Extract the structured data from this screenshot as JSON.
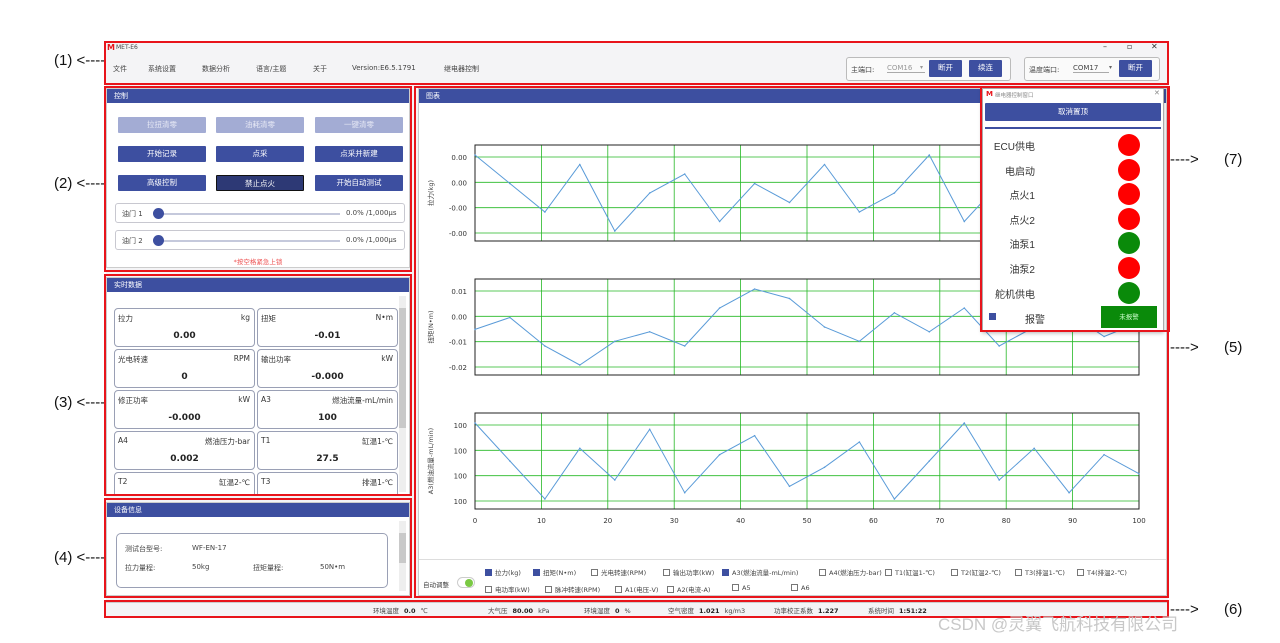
{
  "annotations": [
    "(1) <----",
    "(2) <----",
    "(3) <----",
    "(4) <----",
    "(5)",
    "(6)",
    "(7)"
  ],
  "app": {
    "title": "MET-E6",
    "menu": [
      "文件",
      "系统设置",
      "数据分析",
      "语言/主题",
      "关于",
      "Version:E6.5.1791",
      "继电器控制"
    ],
    "main_port_label": "主端口:",
    "main_port_value": "COM16",
    "disconnect": "断开",
    "resume": "续连",
    "temp_port_label": "温度端口:",
    "temp_port_value": "COM17",
    "temp_disconnect": "断开"
  },
  "control": {
    "title": "控制",
    "buttons": [
      "拉扭清零",
      "油耗清零",
      "一键清零",
      "开始记录",
      "点采",
      "点采并新建",
      "高级控制",
      "禁止点火",
      "开始自动测试"
    ],
    "throttle1_label": "油门 1",
    "throttle1_value": "0.0% /1,000μs",
    "throttle1_level": 0,
    "throttle2_label": "油门 2",
    "throttle2_value": "0.0% /1,000μs",
    "throttle2_level": 0,
    "hint": "*按空格紧急上锁"
  },
  "realtime": {
    "title": "实时数据",
    "cards": [
      {
        "name": "拉力",
        "unit": "kg",
        "value": "0.00"
      },
      {
        "name": "扭矩",
        "unit": "N•m",
        "value": "-0.01"
      },
      {
        "name": "光电转速",
        "unit": "RPM",
        "value": "0"
      },
      {
        "name": "输出功率",
        "unit": "kW",
        "value": "-0.000"
      },
      {
        "name": "修正功率",
        "unit": "kW",
        "value": "-0.000"
      },
      {
        "name": "A3",
        "unit": "燃油流量-mL/min",
        "value": "100"
      },
      {
        "name": "A4",
        "unit": "燃油压力-bar",
        "value": "0.002"
      },
      {
        "name": "T1",
        "unit": "缸温1-℃",
        "value": "27.5"
      },
      {
        "name": "T2",
        "unit": "缸温2-℃",
        "value": ""
      },
      {
        "name": "T3",
        "unit": "排温1-℃",
        "value": ""
      }
    ]
  },
  "device": {
    "title": "设备信息",
    "model_label": "测试台型号:",
    "model_value": "WF-EN-17",
    "thrust_label": "拉力量程:",
    "thrust_value": "50kg",
    "torque_label": "扭矩量程:",
    "torque_value": "50N•m"
  },
  "chart_panel": {
    "title": "图表",
    "auto_label": "自动调整",
    "checkboxes": [
      {
        "label": "拉力(kg)",
        "checked": true
      },
      {
        "label": "扭矩(N•m)",
        "checked": true
      },
      {
        "label": "光电转速(RPM)",
        "checked": false
      },
      {
        "label": "输出功率(kW)",
        "checked": false
      },
      {
        "label": "A3(燃油流量-mL/min)",
        "checked": true
      },
      {
        "label": "A4(燃油压力-bar)",
        "checked": false
      },
      {
        "label": "T1(缸温1-℃)",
        "checked": false
      },
      {
        "label": "T2(缸温2-℃)",
        "checked": false
      },
      {
        "label": "T3(排温1-℃)",
        "checked": false
      },
      {
        "label": "T4(排温2-℃)",
        "checked": false
      },
      {
        "label": "电功率(kW)",
        "checked": false
      },
      {
        "label": "脉冲转速(RPM)",
        "checked": false
      },
      {
        "label": "A1(电压-V)",
        "checked": false
      },
      {
        "label": "A2(电流-A)",
        "checked": false
      },
      {
        "label": "A5",
        "checked": false
      },
      {
        "label": "A6",
        "checked": false
      }
    ]
  },
  "chart_data": [
    {
      "type": "line",
      "ylabel": "拉力(kg)",
      "yticks": [
        "0.00",
        "0.00",
        "-0.00",
        "-0.00"
      ],
      "x": [
        0,
        100
      ],
      "values": [
        0.004,
        0.001,
        -0.002,
        0.003,
        -0.004,
        0.0,
        0.002,
        -0.003,
        0.001,
        -0.001,
        0.003,
        -0.002,
        0.0,
        0.004,
        -0.003,
        0.001,
        -0.002,
        0.003,
        0.0,
        -0.001
      ]
    },
    {
      "type": "line",
      "ylabel": "扭矩(N•m)",
      "yticks": [
        "0.01",
        "0.00",
        "-0.01",
        "-0.02"
      ],
      "x": [
        0,
        100
      ],
      "values": [
        -0.005,
        0.0,
        -0.012,
        -0.02,
        -0.01,
        -0.006,
        -0.012,
        0.004,
        0.012,
        0.008,
        -0.004,
        -0.01,
        0.002,
        -0.006,
        0.004,
        -0.012,
        -0.004,
        0.002,
        -0.008,
        -0.002
      ]
    },
    {
      "type": "line",
      "ylabel": "A3(燃油流量-mL/min)",
      "yticks": [
        "100",
        "100",
        "100",
        "100"
      ],
      "x": [
        0,
        100
      ],
      "xticks": [
        "0",
        "10",
        "20",
        "30",
        "40",
        "50",
        "60",
        "70",
        "80",
        "90",
        "100"
      ],
      "values": [
        100.8,
        100.2,
        99.6,
        100.4,
        99.9,
        100.7,
        99.7,
        100.3,
        100.6,
        99.8,
        100.1,
        100.5,
        99.6,
        100.2,
        100.8,
        99.9,
        100.4,
        99.7,
        100.3,
        100.0
      ]
    }
  ],
  "relay": {
    "title": "继电器控制窗口",
    "cancel_top": "取消置顶",
    "items": [
      {
        "label": "ECU供电",
        "color": "#ff0000"
      },
      {
        "label": "电启动",
        "color": "#ff0000"
      },
      {
        "label": "点火1",
        "color": "#ff0000"
      },
      {
        "label": "点火2",
        "color": "#ff0000"
      },
      {
        "label": "油泵1",
        "color": "#0a8a0a"
      },
      {
        "label": "油泵2",
        "color": "#ff0000"
      },
      {
        "label": "舵机供电",
        "color": "#0a8a0a"
      }
    ],
    "alarm_label": "报警",
    "alarm_btn": "未报警"
  },
  "status": {
    "items": [
      {
        "label": "环境温度",
        "value": "0.0",
        "unit": "℃"
      },
      {
        "label": "大气压",
        "value": "80.00",
        "unit": "kPa"
      },
      {
        "label": "环境湿度",
        "value": "0",
        "unit": "%"
      },
      {
        "label": "空气密度",
        "value": "1.021",
        "unit": "kg/m3"
      },
      {
        "label": "功率校正系数",
        "value": "1.227",
        "unit": ""
      },
      {
        "label": "系统时间",
        "value": "1:51:22",
        "unit": ""
      }
    ]
  },
  "watermark": "CSDN @灵翼飞航科技有限公司"
}
